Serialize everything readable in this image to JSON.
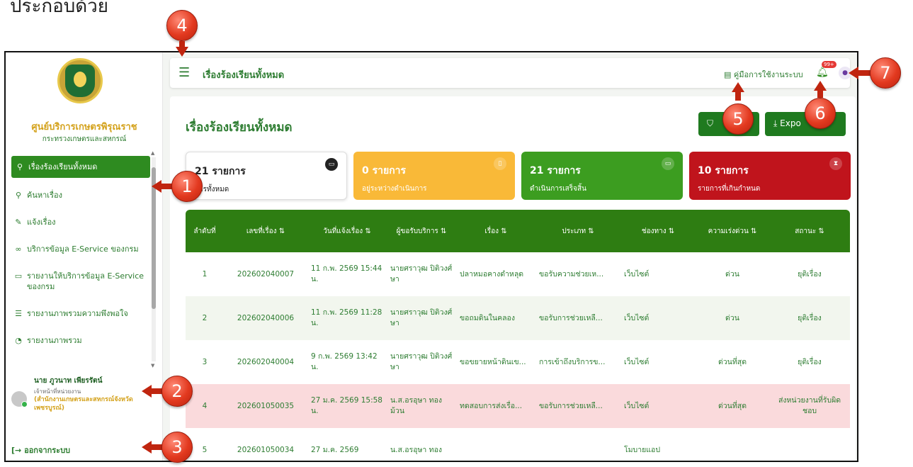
{
  "intro_text": "ประกอบด้วย",
  "sidebar": {
    "org_name": "ศูนย์บริการเกษตรพิรุณราช",
    "org_sub": "กระทรวงเกษตรและสหกรณ์",
    "items": [
      {
        "icon": "search-icon",
        "glyph": "⚲",
        "label": "เรื่องร้องเรียนทั้งหมด",
        "active": true
      },
      {
        "icon": "search-icon",
        "glyph": "⚲",
        "label": "ค้นหาเรื่อง"
      },
      {
        "icon": "edit-icon",
        "glyph": "✎",
        "label": "แจ้งเรื่อง"
      },
      {
        "icon": "link-icon",
        "glyph": "∞",
        "label": "บริการข้อมูล E-Service ของกรม"
      },
      {
        "icon": "monitor-icon",
        "glyph": "▭",
        "label": "รายงานให้บริการข้อมูล E-Service ของกรม"
      },
      {
        "icon": "list-icon",
        "glyph": "☰",
        "label": "รายงานภาพรวมความพึงพอใจ"
      },
      {
        "icon": "chart-icon",
        "glyph": "◔",
        "label": "รายงานภาพรวม"
      }
    ],
    "user": {
      "name": "นาย ภูวนาท เพียรรัตน์",
      "role": "เจ้าหน้าที่หน่วยงาน",
      "office": "(สำนักงานเกษตรและสหกรณ์จังหวัดเพชรบูรณ์)"
    },
    "logout": "ออกจากระบบ"
  },
  "topbar": {
    "title": "เรื่องร้องเรียนทั้งหมด",
    "manual": "คู่มือการใช้งานระบบ",
    "badge": "99+"
  },
  "main": {
    "title": "เรื่องร้องเรียนทั้งหมด",
    "filter_label": "",
    "export_label": "Expo"
  },
  "cards": [
    {
      "count": "21 รายการ",
      "desc": "การทั้งหมด",
      "icon": "folder-icon"
    },
    {
      "count": "0 รายการ",
      "desc": "อยู่ระหว่างดำเนินการ",
      "icon": "document-icon"
    },
    {
      "count": "21 รายการ",
      "desc": "ดำเนินการเสร็จสิ้น",
      "icon": "folder-icon"
    },
    {
      "count": "10 รายการ",
      "desc": "รายการที่เกินกำหนด",
      "icon": "hourglass-icon"
    }
  ],
  "table": {
    "headers": [
      "ลำดับที่",
      "เลขที่เรื่อง ⇅",
      "วันที่แจ้งเรื่อง ⇅",
      "ผู้ขอรับบริการ ⇅",
      "เรื่อง ⇅",
      "ประเภท ⇅",
      "ช่องทาง ⇅",
      "ความเร่งด่วน ⇅",
      "สถานะ ⇅"
    ],
    "rows": [
      [
        "1",
        "202602040007",
        "11 ก.พ. 2569 15:44 น.",
        "นายศราวุฒ ปิติวงศ์ษา",
        "ปลาหมอคางดำหลุด",
        "ขอรับความช่วยเห...",
        "เว็บไซต์",
        "ด่วน",
        "ยุติเรื่อง"
      ],
      [
        "2",
        "202602040006",
        "11 ก.พ. 2569 11:28 น.",
        "นายศราวุฒ ปิติวงศ์ษา",
        "ขอถมดินในคลอง",
        "ขอรับการช่วยเหลื...",
        "เว็บไซต์",
        "ด่วน",
        "ยุติเรื่อง"
      ],
      [
        "3",
        "202602040004",
        "9 ก.พ. 2569 13:42 น.",
        "นายศราวุฒ ปิติวงศ์ษา",
        "ขอขยายหน้าดินเข...",
        "การเข้าถึงบริการข...",
        "เว็บไซต์",
        "ด่วนที่สุด",
        "ยุติเรื่อง"
      ],
      [
        "4",
        "202601050035",
        "27 ม.ค. 2569 15:58 น.",
        "น.ส.อรอุษา ทองม้วน",
        "ทดสอบการส่งเรื่อ...",
        "ขอรับการช่วยเหลื...",
        "เว็บไซต์",
        "ด่วนที่สุด",
        "ส่งหน่วยงานที่รับผิดชอบ"
      ],
      [
        "5",
        "202601050034",
        "27 ม.ค. 2569",
        "น.ส.อรอุษา ทอง",
        "",
        "",
        "โมบายแอป",
        "",
        ""
      ]
    ]
  },
  "callouts": [
    "1",
    "2",
    "3",
    "4",
    "5",
    "6",
    "7"
  ],
  "colors": {
    "primary": "#2e7d12",
    "warning": "#f9b938",
    "success": "#3c9d20",
    "danger": "#c0141c",
    "callout": "#e2391f"
  }
}
